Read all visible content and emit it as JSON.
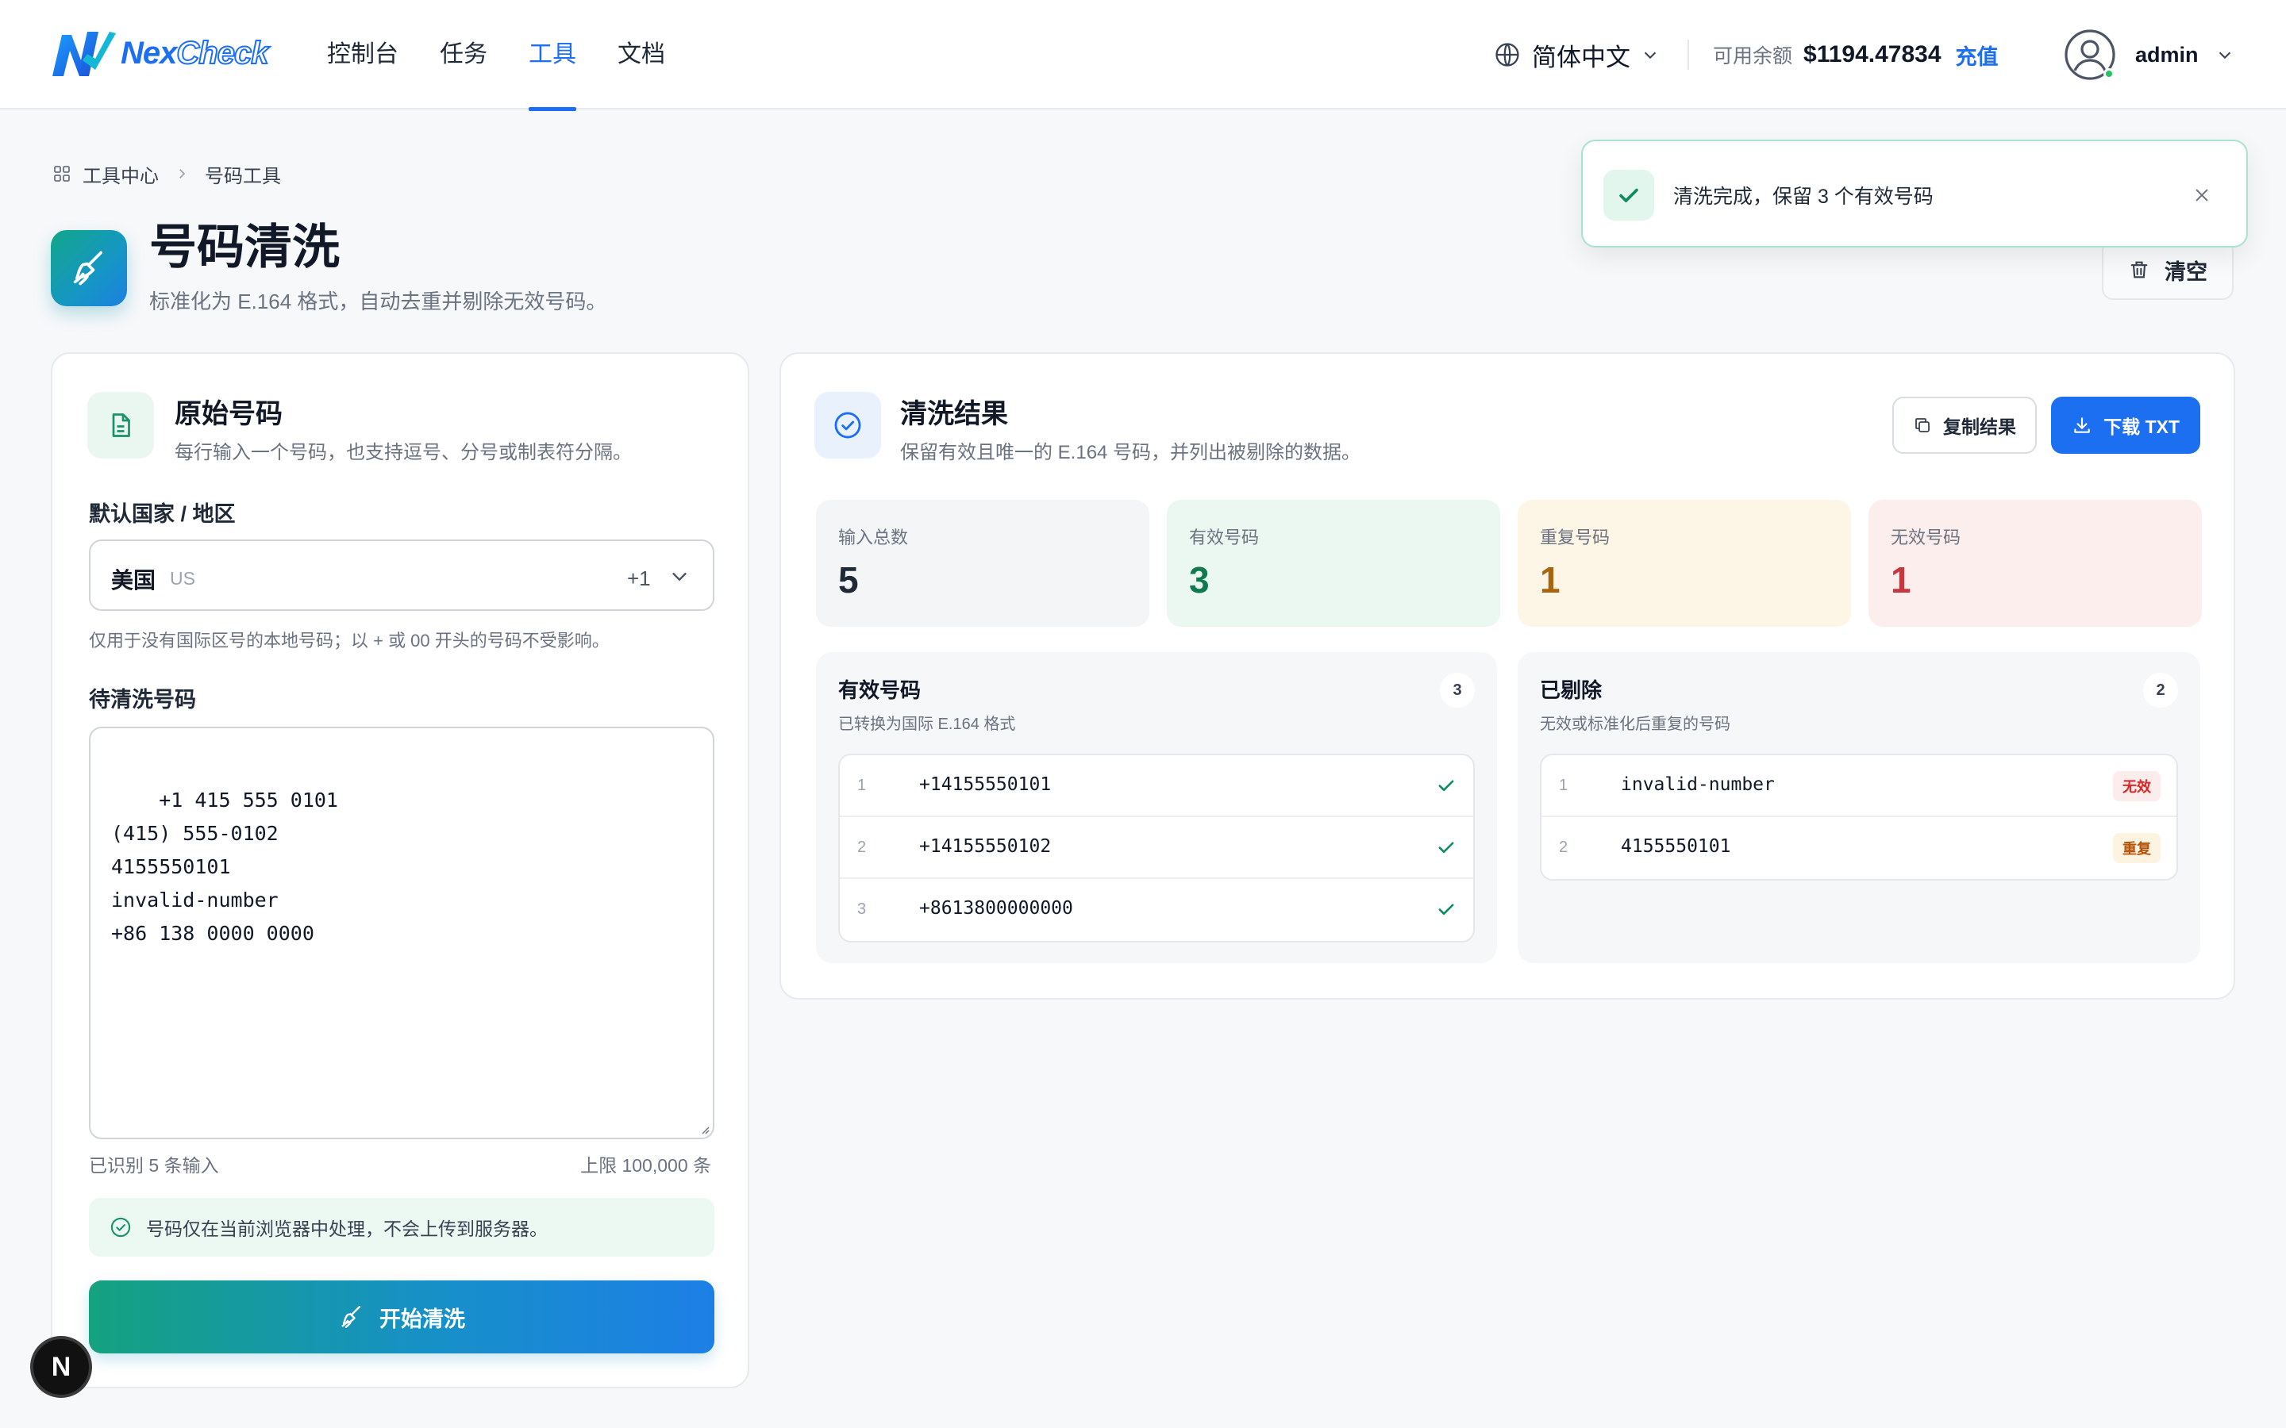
{
  "app": {
    "logo": {
      "part1": "Nex",
      "part2": "Check"
    },
    "nav": [
      {
        "label": "控制台",
        "active": false
      },
      {
        "label": "任务",
        "active": false
      },
      {
        "label": "工具",
        "active": true
      },
      {
        "label": "文档",
        "active": false
      }
    ],
    "language": "简体中文",
    "balance": {
      "label": "可用余额",
      "amount": "$1194.47834",
      "topup": "充值"
    },
    "user": {
      "name": "admin",
      "online": true
    },
    "accent_color": "#1d6ff2"
  },
  "breadcrumb": [
    "工具中心",
    "号码工具"
  ],
  "page": {
    "title": "号码清洗",
    "subtitle": "标准化为 E.164 格式，自动去重并剔除无效号码。",
    "clear_label": "清空"
  },
  "toast": {
    "message": "清洗完成，保留 3 个有效号码",
    "type": "success"
  },
  "input_card": {
    "title": "原始号码",
    "desc": "每行输入一个号码，也支持逗号、分号或制表符分隔。",
    "country_label": "默认国家 / 地区",
    "country": {
      "name": "美国",
      "code": "US",
      "dial": "+1"
    },
    "country_hint": "仅用于没有国际区号的本地号码；以 + 或 00 开头的号码不受影响。",
    "numbers_label": "待清洗号码",
    "numbers_text": "+1 415 555 0101\n(415) 555-0102\n4155550101\ninvalid-number\n+86 138 0000 0000",
    "recognized": "已识别 5 条输入",
    "limit": "上限 100,000 条",
    "privacy": "号码仅在当前浏览器中处理，不会上传到服务器。",
    "start_label": "开始清洗"
  },
  "result_card": {
    "title": "清洗结果",
    "desc": "保留有效且唯一的 E.164 号码，并列出被剔除的数据。",
    "copy_label": "复制结果",
    "download_label": "下载 TXT",
    "stats": [
      {
        "label": "输入总数",
        "value": "5",
        "bg": "#f3f5f7",
        "color": "#1f2937"
      },
      {
        "label": "有效号码",
        "value": "3",
        "bg": "#ebf7f1",
        "color": "#0f7a4f"
      },
      {
        "label": "重复号码",
        "value": "1",
        "bg": "#fdf6e7",
        "color": "#a8650d"
      },
      {
        "label": "无效号码",
        "value": "1",
        "bg": "#fdeeee",
        "color": "#c8363f"
      }
    ],
    "valid": {
      "title": "有效号码",
      "sub": "已转换为国际 E.164 格式",
      "count": "3",
      "rows": [
        {
          "idx": "1",
          "num": "+14155550101"
        },
        {
          "idx": "2",
          "num": "+14155550102"
        },
        {
          "idx": "3",
          "num": "+8613800000000"
        }
      ]
    },
    "removed": {
      "title": "已剔除",
      "sub": "无效或标准化后重复的号码",
      "count": "2",
      "rows": [
        {
          "idx": "1",
          "num": "invalid-number",
          "badge": "无效",
          "badge_color": "#dc2626",
          "badge_bg": "#fdecec"
        },
        {
          "idx": "2",
          "num": "4155550101",
          "badge": "重复",
          "badge_color": "#b45309",
          "badge_bg": "#fdf3e1"
        }
      ]
    }
  },
  "fab_label": "N"
}
